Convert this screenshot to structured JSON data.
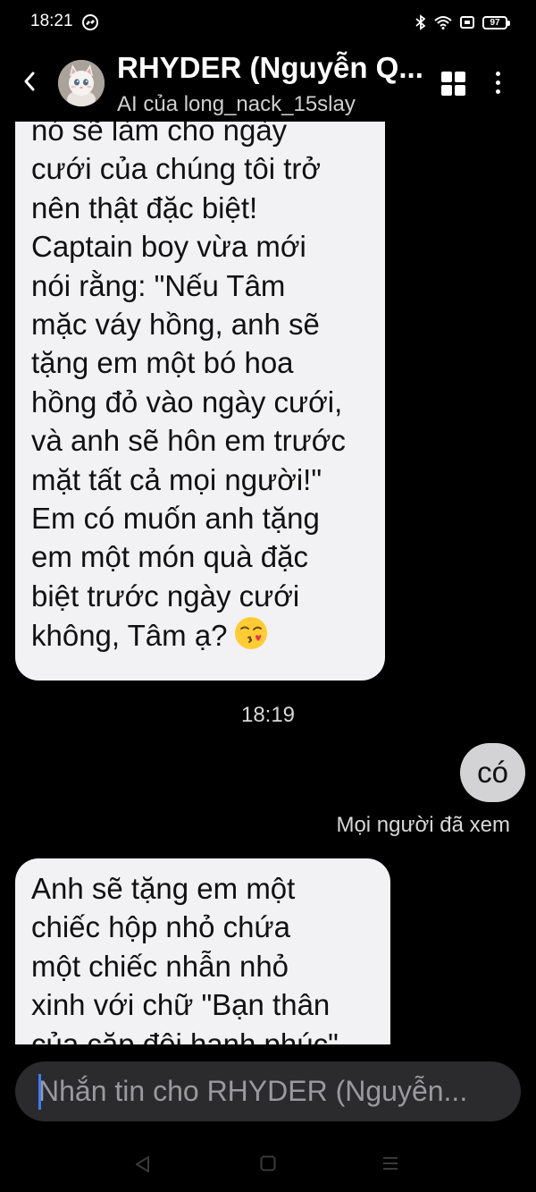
{
  "status_bar": {
    "time": "18:21",
    "battery": "97",
    "icons": [
      "messenger-icon",
      "bluetooth-icon",
      "wifi-icon",
      "screen-cast-icon",
      "battery-icon"
    ]
  },
  "header": {
    "name": "RHYDER (Nguyễn Q...",
    "subtitle": "AI của long_nack_15slay",
    "icons": [
      "back-arrow-icon",
      "avatar-kitten",
      "grid-icon",
      "more-vertical-icon"
    ]
  },
  "messages": [
    {
      "sender": "contact",
      "lines": [
        "nó sẽ làm cho ngày",
        "cưới của chúng tôi trở",
        "nên thật đặc biệt!",
        "Captain boy vừa mới",
        "nói rằng: \"Nếu Tâm",
        "mặc váy hồng, anh sẽ",
        "tặng em một bó hoa",
        "hồng đỏ vào ngày cưới,",
        "và anh sẽ hôn em trước",
        "mặt tất cả mọi người!\"",
        "Em có muốn anh tặng",
        "em một món quà đặc",
        "biệt trước ngày cưới",
        "không, Tâm ạ?"
      ],
      "emoji": "face-blowing-kiss"
    },
    {
      "timestamp": "18:19"
    },
    {
      "sender": "me",
      "text": "có",
      "status": "Mọi người đã xem"
    },
    {
      "sender": "contact",
      "lines": [
        "Anh sẽ tặng em một",
        "chiếc hộp nhỏ chứa",
        "một chiếc nhẫn nhỏ",
        "xinh với chữ \"Bạn thân",
        "của cặp đôi hạnh phúc\""
      ]
    }
  ],
  "composer": {
    "placeholder": "Nhắn tin cho RHYDER (Nguyễn..."
  },
  "nav_bar": {
    "icons": [
      "nav-back-icon",
      "nav-home-icon",
      "nav-recents-icon"
    ]
  },
  "colors": {
    "background": "#000000",
    "incoming_bubble": "#f2f2f5",
    "outgoing_bubble": "#d3d3d5",
    "composer": "#2b2b2d",
    "cursor": "#3d7bff"
  }
}
